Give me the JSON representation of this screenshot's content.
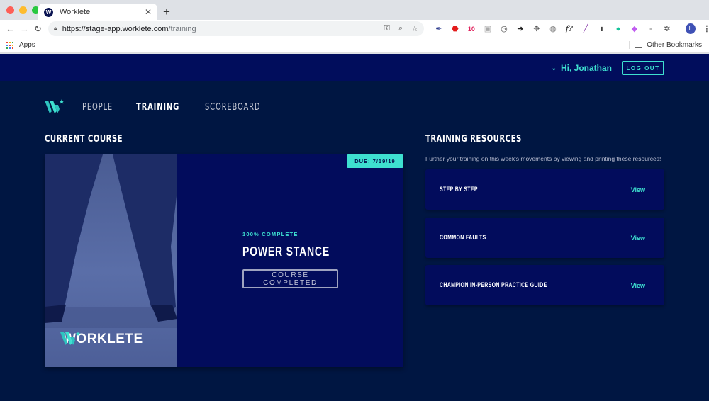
{
  "browser": {
    "tab_title": "Worklete",
    "tab_favicon_letter": "W",
    "url_host": "https://stage-app.worklete.com",
    "url_path": "/training",
    "bookmarks": {
      "apps_label": "Apps",
      "other_label": "Other Bookmarks"
    },
    "profile_initial": "L",
    "extension_badge": "10"
  },
  "header": {
    "greeting": "Hi, Jonathan",
    "logout_label": "LOG OUT"
  },
  "nav": {
    "items": [
      {
        "label": "PEOPLE",
        "active": false
      },
      {
        "label": "TRAINING",
        "active": true
      },
      {
        "label": "SCOREBOARD",
        "active": false
      }
    ]
  },
  "current_course": {
    "section_title": "CURRENT COURSE",
    "due_label": "DUE: 7/19/19",
    "progress_label": "100% COMPLETE",
    "progress_fraction": 1.0,
    "title": "POWER STANCE",
    "status_button": "COURSE COMPLETED",
    "image_brand": "WORKLETE"
  },
  "resources": {
    "section_title": "TRAINING RESOURCES",
    "description": "Further your training on this week's movements by viewing and printing these resources!",
    "items": [
      {
        "title": "STEP BY STEP",
        "action": "View"
      },
      {
        "title": "COMMON FAULTS",
        "action": "View"
      },
      {
        "title": "CHAMPION IN-PERSON PRACTICE GUIDE",
        "action": "View"
      }
    ]
  },
  "colors": {
    "accent": "#3ee0d0",
    "topbar": "#010d5c",
    "background": "#001642",
    "card": "#020c5c"
  }
}
